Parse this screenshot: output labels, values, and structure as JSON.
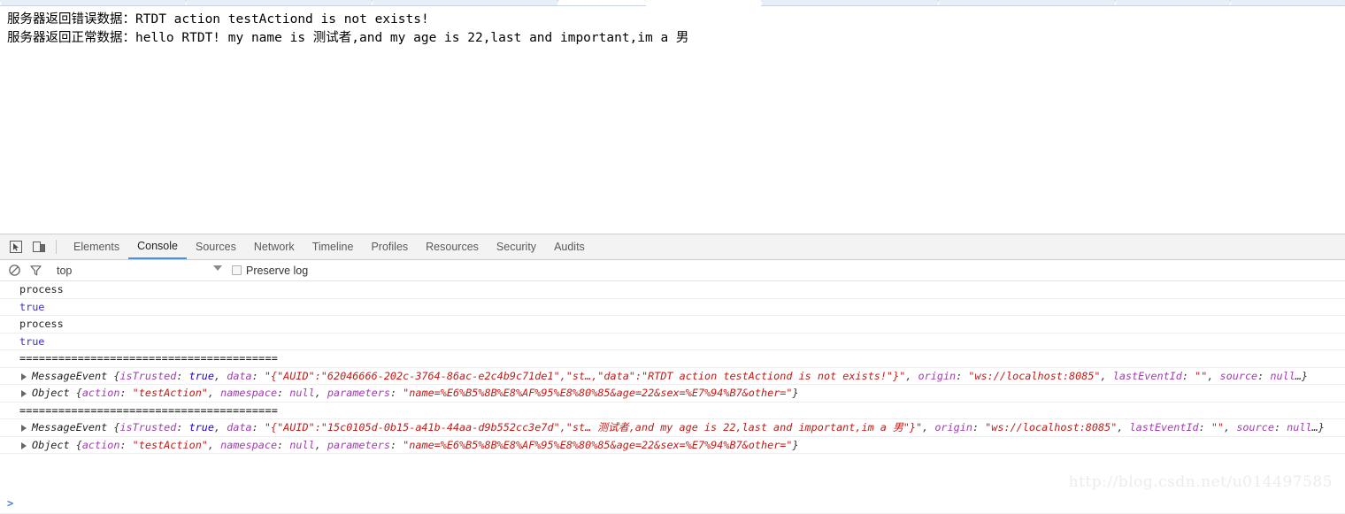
{
  "browser_chrome": {
    "tabs_visible": true,
    "tab_strip_color": "#dee6f2"
  },
  "page": {
    "lines": [
      "服务器返回错误数据：RTDT action testActiond is not exists!",
      "服务器返回正常数据：hello RTDT! my name is 测试者,and my age is 22,last and important,im a 男"
    ]
  },
  "devtools": {
    "toolbar": {
      "inspect_icon": "inspect-element-icon",
      "device_icon": "device-toolbar-icon",
      "tabs": [
        {
          "label": "Elements",
          "active": false
        },
        {
          "label": "Console",
          "active": true
        },
        {
          "label": "Sources",
          "active": false
        },
        {
          "label": "Network",
          "active": false
        },
        {
          "label": "Timeline",
          "active": false
        },
        {
          "label": "Profiles",
          "active": false
        },
        {
          "label": "Resources",
          "active": false
        },
        {
          "label": "Security",
          "active": false
        },
        {
          "label": "Audits",
          "active": false
        }
      ],
      "active_tab": "Console",
      "active_tab_underline_color": "#4a90e2"
    },
    "filter_bar": {
      "clear_icon": "clear-console-icon",
      "filter_icon": "filter-icon",
      "context_selector_value": "top",
      "context_caret_icon": "chevron-down-icon",
      "preserve_log_label": "Preserve log",
      "preserve_log_checked": false
    },
    "console": {
      "prompt_symbol": ">",
      "rows": [
        {
          "type": "text",
          "text": "process"
        },
        {
          "type": "bool",
          "text": "true"
        },
        {
          "type": "text",
          "text": "process"
        },
        {
          "type": "bool",
          "text": "true"
        },
        {
          "type": "separator",
          "text": "========================================"
        },
        {
          "type": "object",
          "expander": "disclosure-triangle-icon",
          "class_name": "MessageEvent",
          "preview": "{isTrusted: true, data: \"{\"AUID\":\"62046666-202c-3764-86ac-e2c4b9c71de1\",\"st…,\"data\":\"RTDT action testActiond is not exists!\"}\", origin: \"ws://localhost:8085\", lastEventId: \"\", source: null…}",
          "tokens": [
            {
              "t": "cls",
              "v": "MessageEvent "
            },
            {
              "t": "pun",
              "v": "{"
            },
            {
              "t": "key",
              "v": "isTrusted"
            },
            {
              "t": "pun",
              "v": ": "
            },
            {
              "t": "num",
              "v": "true"
            },
            {
              "t": "pun",
              "v": ", "
            },
            {
              "t": "key",
              "v": "data"
            },
            {
              "t": "pun",
              "v": ": "
            },
            {
              "t": "str",
              "v": "\"{\"AUID\":\"62046666-202c-3764-86ac-e2c4b9c71de1\",\"st…,\"data\":\"RTDT action testActiond is not exists!\"}\""
            },
            {
              "t": "pun",
              "v": ", "
            },
            {
              "t": "key",
              "v": "origin"
            },
            {
              "t": "pun",
              "v": ": "
            },
            {
              "t": "str",
              "v": "\"ws://localhost:8085\""
            },
            {
              "t": "pun",
              "v": ", "
            },
            {
              "t": "key",
              "v": "lastEventId"
            },
            {
              "t": "pun",
              "v": ": "
            },
            {
              "t": "str",
              "v": "\"\""
            },
            {
              "t": "pun",
              "v": ", "
            },
            {
              "t": "key",
              "v": "source"
            },
            {
              "t": "pun",
              "v": ": "
            },
            {
              "t": "null",
              "v": "null"
            },
            {
              "t": "pun",
              "v": "…}"
            }
          ]
        },
        {
          "type": "object",
          "expander": "disclosure-triangle-icon",
          "class_name": "Object",
          "preview": "{action: \"testAction\", namespace: null, parameters: \"name=%E6%B5%8B%E8%AF%95%E8%80%85&age=22&sex=%E7%94%B7&other=\"}",
          "tokens": [
            {
              "t": "cls",
              "v": "Object "
            },
            {
              "t": "pun",
              "v": "{"
            },
            {
              "t": "key",
              "v": "action"
            },
            {
              "t": "pun",
              "v": ": "
            },
            {
              "t": "str",
              "v": "\"testAction\""
            },
            {
              "t": "pun",
              "v": ", "
            },
            {
              "t": "key",
              "v": "namespace"
            },
            {
              "t": "pun",
              "v": ": "
            },
            {
              "t": "null",
              "v": "null"
            },
            {
              "t": "pun",
              "v": ", "
            },
            {
              "t": "key",
              "v": "parameters"
            },
            {
              "t": "pun",
              "v": ": "
            },
            {
              "t": "str",
              "v": "\"name=%E6%B5%8B%E8%AF%95%E8%80%85&age=22&sex=%E7%94%B7&other=\""
            },
            {
              "t": "pun",
              "v": "}"
            }
          ]
        },
        {
          "type": "separator",
          "text": "========================================"
        },
        {
          "type": "object",
          "expander": "disclosure-triangle-icon",
          "class_name": "MessageEvent",
          "preview": "{isTrusted: true, data: \"{\"AUID\":\"15c0105d-0b15-a41b-44aa-d9b552cc3e7d\",\"st… 测试者,and my age is 22,last and important,im a 男\"}\", origin: \"ws://localhost:8085\", lastEventId: \"\", source: null…}",
          "tokens": [
            {
              "t": "cls",
              "v": "MessageEvent "
            },
            {
              "t": "pun",
              "v": "{"
            },
            {
              "t": "key",
              "v": "isTrusted"
            },
            {
              "t": "pun",
              "v": ": "
            },
            {
              "t": "num",
              "v": "true"
            },
            {
              "t": "pun",
              "v": ", "
            },
            {
              "t": "key",
              "v": "data"
            },
            {
              "t": "pun",
              "v": ": "
            },
            {
              "t": "str",
              "v": "\"{\"AUID\":\"15c0105d-0b15-a41b-44aa-d9b552cc3e7d\",\"st… 测试者,and my age is 22,last and important,im a 男\"}\""
            },
            {
              "t": "pun",
              "v": ", "
            },
            {
              "t": "key",
              "v": "origin"
            },
            {
              "t": "pun",
              "v": ": "
            },
            {
              "t": "str",
              "v": "\"ws://localhost:8085\""
            },
            {
              "t": "pun",
              "v": ", "
            },
            {
              "t": "key",
              "v": "lastEventId"
            },
            {
              "t": "pun",
              "v": ": "
            },
            {
              "t": "str",
              "v": "\"\""
            },
            {
              "t": "pun",
              "v": ", "
            },
            {
              "t": "key",
              "v": "source"
            },
            {
              "t": "pun",
              "v": ": "
            },
            {
              "t": "null",
              "v": "null"
            },
            {
              "t": "pun",
              "v": "…}"
            }
          ]
        },
        {
          "type": "object",
          "expander": "disclosure-triangle-icon",
          "class_name": "Object",
          "preview": "{action: \"testAction\", namespace: null, parameters: \"name=%E6%B5%8B%E8%AF%95%E8%80%85&age=22&sex=%E7%94%B7&other=\"}",
          "tokens": [
            {
              "t": "cls",
              "v": "Object "
            },
            {
              "t": "pun",
              "v": "{"
            },
            {
              "t": "key",
              "v": "action"
            },
            {
              "t": "pun",
              "v": ": "
            },
            {
              "t": "str",
              "v": "\"testAction\""
            },
            {
              "t": "pun",
              "v": ", "
            },
            {
              "t": "key",
              "v": "namespace"
            },
            {
              "t": "pun",
              "v": ": "
            },
            {
              "t": "null",
              "v": "null"
            },
            {
              "t": "pun",
              "v": ", "
            },
            {
              "t": "key",
              "v": "parameters"
            },
            {
              "t": "pun",
              "v": ": "
            },
            {
              "t": "str",
              "v": "\"name=%E6%B5%8B%E8%AF%95%E8%80%85&age=22&sex=%E7%94%B7&other=\""
            },
            {
              "t": "pun",
              "v": "}"
            }
          ]
        }
      ]
    }
  },
  "watermark": {
    "text": "http://blog.csdn.net/u014497585"
  }
}
